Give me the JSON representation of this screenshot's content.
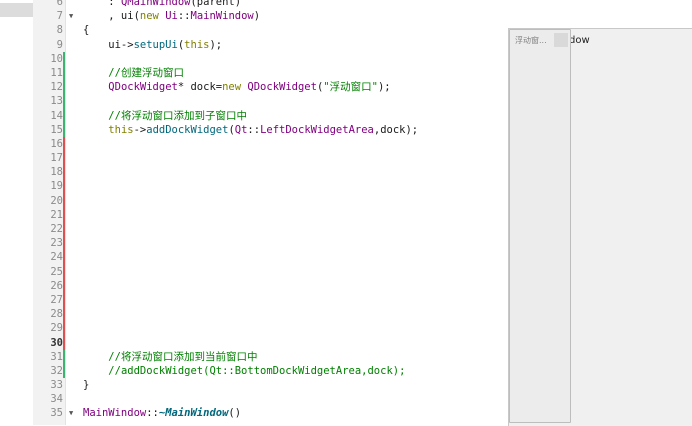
{
  "editor": {
    "lines": [
      {
        "num": "6",
        "fold": "",
        "mark": "",
        "html": "    : <span class=\"ty\">QMainWindow</span>(parent)"
      },
      {
        "num": "7",
        "fold": "▼",
        "mark": "",
        "html": "    , ui(<span class=\"kw\">new</span> <span class=\"ty\">Ui</span>::<span class=\"ty\">MainWindow</span>)"
      },
      {
        "num": "8",
        "fold": "",
        "mark": "",
        "html": "{"
      },
      {
        "num": "9",
        "fold": "",
        "mark": "",
        "html": "    ui-><span class=\"fn\">setupUi</span>(<span class=\"kw\">this</span>);"
      },
      {
        "num": "10",
        "fold": "",
        "mark": "added",
        "html": ""
      },
      {
        "num": "11",
        "fold": "",
        "mark": "added",
        "html": "    <span class=\"cm\">//创建浮动窗口</span>"
      },
      {
        "num": "12",
        "fold": "",
        "mark": "added",
        "html": "    <span class=\"ty\">QDockWidget</span>* dock=<span class=\"kw\">new</span> <span class=\"ty\">QDockWidget</span>(<span class=\"str\">\"浮动窗口\"</span>);"
      },
      {
        "num": "13",
        "fold": "",
        "mark": "added",
        "html": ""
      },
      {
        "num": "14",
        "fold": "",
        "mark": "added",
        "html": "    <span class=\"cm\">//将浮动窗口添加到子窗口中</span>"
      },
      {
        "num": "15",
        "fold": "",
        "mark": "added",
        "html": "    <span class=\"kw\">this</span>-><span class=\"fn\">addDockWidget</span>(<span class=\"ty\">Qt</span>::<span class=\"ty\">LeftDockWidgetArea</span>,dock);"
      },
      {
        "num": "16",
        "fold": "",
        "mark": "modified",
        "html": ""
      },
      {
        "num": "17",
        "fold": "",
        "mark": "modified",
        "html": ""
      },
      {
        "num": "18",
        "fold": "",
        "mark": "modified",
        "html": ""
      },
      {
        "num": "19",
        "fold": "",
        "mark": "modified",
        "html": ""
      },
      {
        "num": "20",
        "fold": "",
        "mark": "modified",
        "html": ""
      },
      {
        "num": "21",
        "fold": "",
        "mark": "modified",
        "html": ""
      },
      {
        "num": "22",
        "fold": "",
        "mark": "modified",
        "html": ""
      },
      {
        "num": "23",
        "fold": "",
        "mark": "modified",
        "html": ""
      },
      {
        "num": "24",
        "fold": "",
        "mark": "modified",
        "html": ""
      },
      {
        "num": "25",
        "fold": "",
        "mark": "modified",
        "html": ""
      },
      {
        "num": "26",
        "fold": "",
        "mark": "modified",
        "html": ""
      },
      {
        "num": "27",
        "fold": "",
        "mark": "modified",
        "html": ""
      },
      {
        "num": "28",
        "fold": "",
        "mark": "modified",
        "html": ""
      },
      {
        "num": "29",
        "fold": "",
        "mark": "modified",
        "html": ""
      },
      {
        "num": "30",
        "fold": "",
        "mark": "modified",
        "html": "",
        "current": true
      },
      {
        "num": "31",
        "fold": "",
        "mark": "added",
        "html": "    <span class=\"cm\">//将浮动窗口添加到当前窗口中</span>"
      },
      {
        "num": "32",
        "fold": "",
        "mark": "added",
        "html": "    <span class=\"cm\">//addDockWidget(Qt::BottomDockWidgetArea,dock);</span>"
      },
      {
        "num": "33",
        "fold": "",
        "mark": "",
        "html": "}"
      },
      {
        "num": "34",
        "fold": "",
        "mark": "",
        "html": ""
      },
      {
        "num": "35",
        "fold": "▼",
        "mark": "",
        "html": "<span class=\"ty\">MainWindow</span>::<span class=\"em\">~MainWindow</span>()"
      }
    ]
  },
  "app_window": {
    "title": "dow",
    "dock_title": "浮动窗..."
  }
}
